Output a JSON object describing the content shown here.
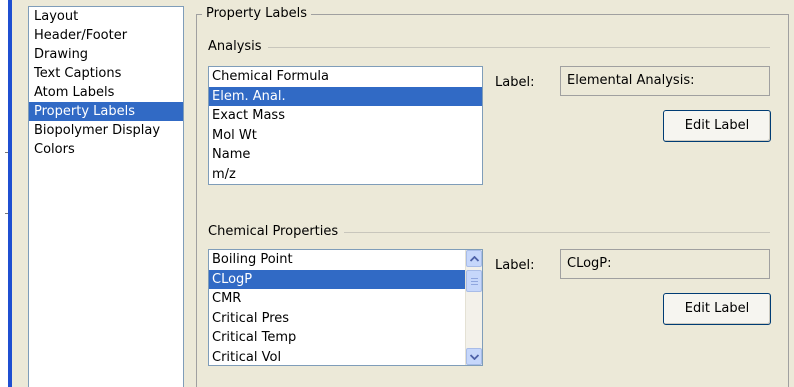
{
  "categories": [
    {
      "label": "Layout"
    },
    {
      "label": "Header/Footer"
    },
    {
      "label": "Drawing"
    },
    {
      "label": "Text Captions"
    },
    {
      "label": "Atom Labels"
    },
    {
      "label": "Property Labels",
      "selected": true
    },
    {
      "label": "Biopolymer Display"
    },
    {
      "label": "Colors"
    }
  ],
  "group_title": "Property Labels",
  "analysis": {
    "section_label": "Analysis",
    "items": [
      "Chemical Formula",
      "Elem. Anal.",
      "Exact Mass",
      "Mol Wt",
      "Name",
      "m/z"
    ],
    "selected_index": 1,
    "label_caption": "Label:",
    "label_value": "Elemental Analysis:",
    "edit_button": "Edit Label"
  },
  "chemical_properties": {
    "section_label": "Chemical Properties",
    "items": [
      "Boiling Point",
      "CLogP",
      "CMR",
      "Critical Pres",
      "Critical Temp",
      "Critical Vol"
    ],
    "selected_index": 1,
    "label_caption": "Label:",
    "label_value": "CLogP:",
    "edit_button": "Edit Label"
  },
  "colors": {
    "selection": "#316ac5",
    "window_bg": "#ece9d8",
    "accent_strip": "#1f4fd1"
  }
}
